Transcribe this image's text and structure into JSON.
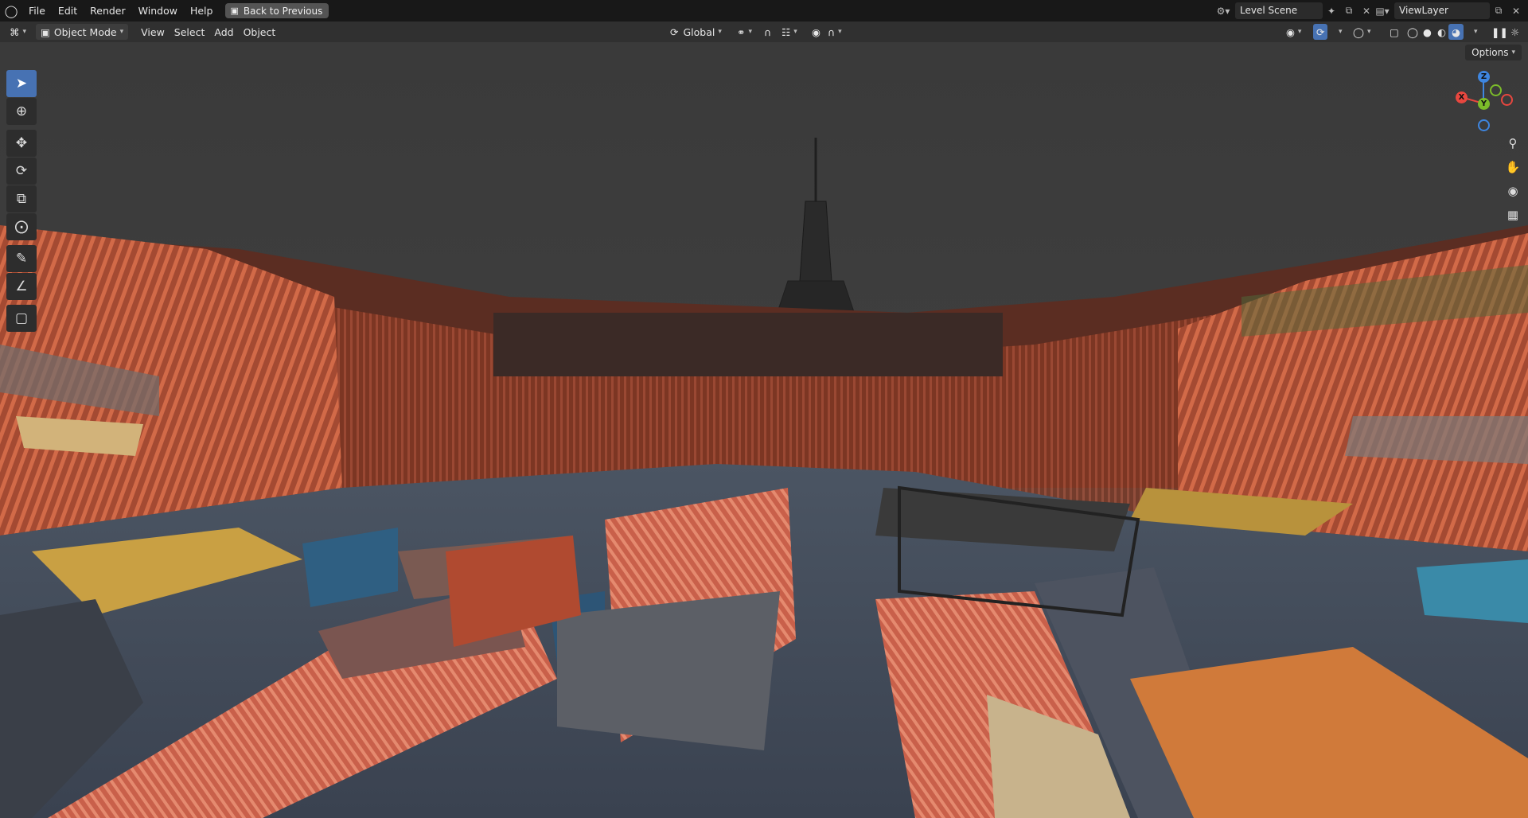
{
  "app": {
    "logo_icon": "blender-icon"
  },
  "menu": [
    "File",
    "Edit",
    "Render",
    "Window",
    "Help"
  ],
  "back_button": "Back to Previous",
  "scene": {
    "name": "Level Scene"
  },
  "view_layer": {
    "name": "ViewLayer"
  },
  "header": {
    "mode": "Object Mode",
    "menus": [
      "View",
      "Select",
      "Add",
      "Object"
    ],
    "orientation": "Global"
  },
  "options_label": "Options",
  "gizmo": {
    "x": "X",
    "y": "Y",
    "z": "Z"
  },
  "colors": {
    "accent": "#4772b3",
    "topbar": "#181818",
    "header": "#303030",
    "sky": "#3b3b3b",
    "axis_x": "#e8473f",
    "axis_y": "#7cbc2a",
    "axis_z": "#3e86e0"
  }
}
